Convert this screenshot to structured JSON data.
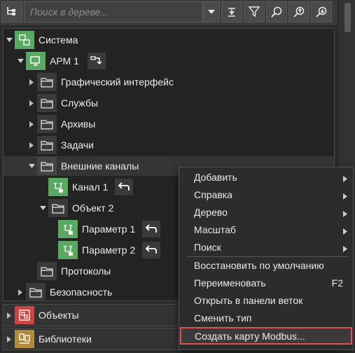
{
  "toolbar": {
    "search_placeholder": "Поиск в дереве..."
  },
  "tree": {
    "system": "Система",
    "arm": "АРМ 1",
    "items": {
      "gui": "Графический интерфейс",
      "services": "Службы",
      "archives": "Архивы",
      "tasks": "Задачи",
      "external": "Внешние каналы",
      "channel1": "Канал 1",
      "object2": "Объект 2",
      "param1": "Параметр 1",
      "param2": "Параметр 2",
      "protocols": "Протоколы",
      "security": "Безопасность"
    }
  },
  "bottom": {
    "objects": "Объекты",
    "libraries": "Библиотеки"
  },
  "context_menu": {
    "add": "Добавить",
    "help": "Справка",
    "tree": "Дерево",
    "scale": "Масштаб",
    "search": "Поиск",
    "restore": "Восстановить по умолчанию",
    "rename": "Переименовать",
    "rename_shortcut": "F2",
    "open_panel": "Открыть в панели веток",
    "change_type": "Сменить тип",
    "create_modbus": "Создать карту Modbus..."
  },
  "colors": {
    "highlight_border": "#e05050",
    "icon_green": "#5aa862"
  }
}
